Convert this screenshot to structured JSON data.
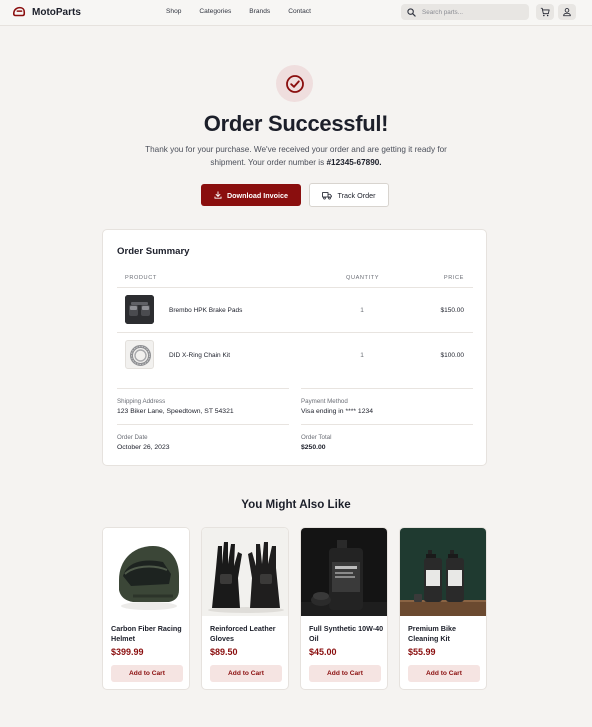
{
  "header": {
    "brand": "MotoParts",
    "nav": [
      "Shop",
      "Categories",
      "Brands",
      "Contact"
    ],
    "search_placeholder": "Search parts...",
    "icons": [
      "search-icon",
      "cart-icon",
      "user-icon"
    ]
  },
  "hero": {
    "title": "Order Successful!",
    "message_part1": "Thank you for your purchase. We've received your order and are getting it ready for shipment. Your order number is ",
    "order_number": "#12345-67890.",
    "download_label": "Download Invoice",
    "track_label": "Track Order"
  },
  "summary": {
    "title": "Order Summary",
    "columns": [
      "PRODUCT",
      "QUANTITY",
      "PRICE"
    ],
    "items": [
      {
        "name": "Brembo HPK Brake Pads",
        "qty": "1",
        "price": "$150.00"
      },
      {
        "name": "DID X-Ring Chain Kit",
        "qty": "1",
        "price": "$100.00"
      }
    ],
    "shipping_label": "Shipping Address",
    "shipping_value": "123 Biker Lane, Speedtown, ST 54321",
    "payment_label": "Payment Method",
    "payment_value": "Visa ending in **** 1234",
    "date_label": "Order Date",
    "date_value": "October 26, 2023",
    "total_label": "Order Total",
    "total_value": "$250.00"
  },
  "recommendations": {
    "title": "You Might Also Like",
    "products": [
      {
        "name": "Carbon Fiber Racing Helmet",
        "price": "$399.99",
        "cta": "Add to Cart"
      },
      {
        "name": "Reinforced Leather Gloves",
        "price": "$89.50",
        "cta": "Add to Cart"
      },
      {
        "name": "Full Synthetic 10W-40 Oil",
        "price": "$45.00",
        "cta": "Add to Cart"
      },
      {
        "name": "Premium Bike Cleaning Kit",
        "price": "$55.99",
        "cta": "Add to Cart"
      }
    ]
  },
  "colors": {
    "accent": "#8a0e0e",
    "accent_light": "#f5e4e2",
    "background": "#f5f3f1",
    "text": "#1c1f2a"
  }
}
